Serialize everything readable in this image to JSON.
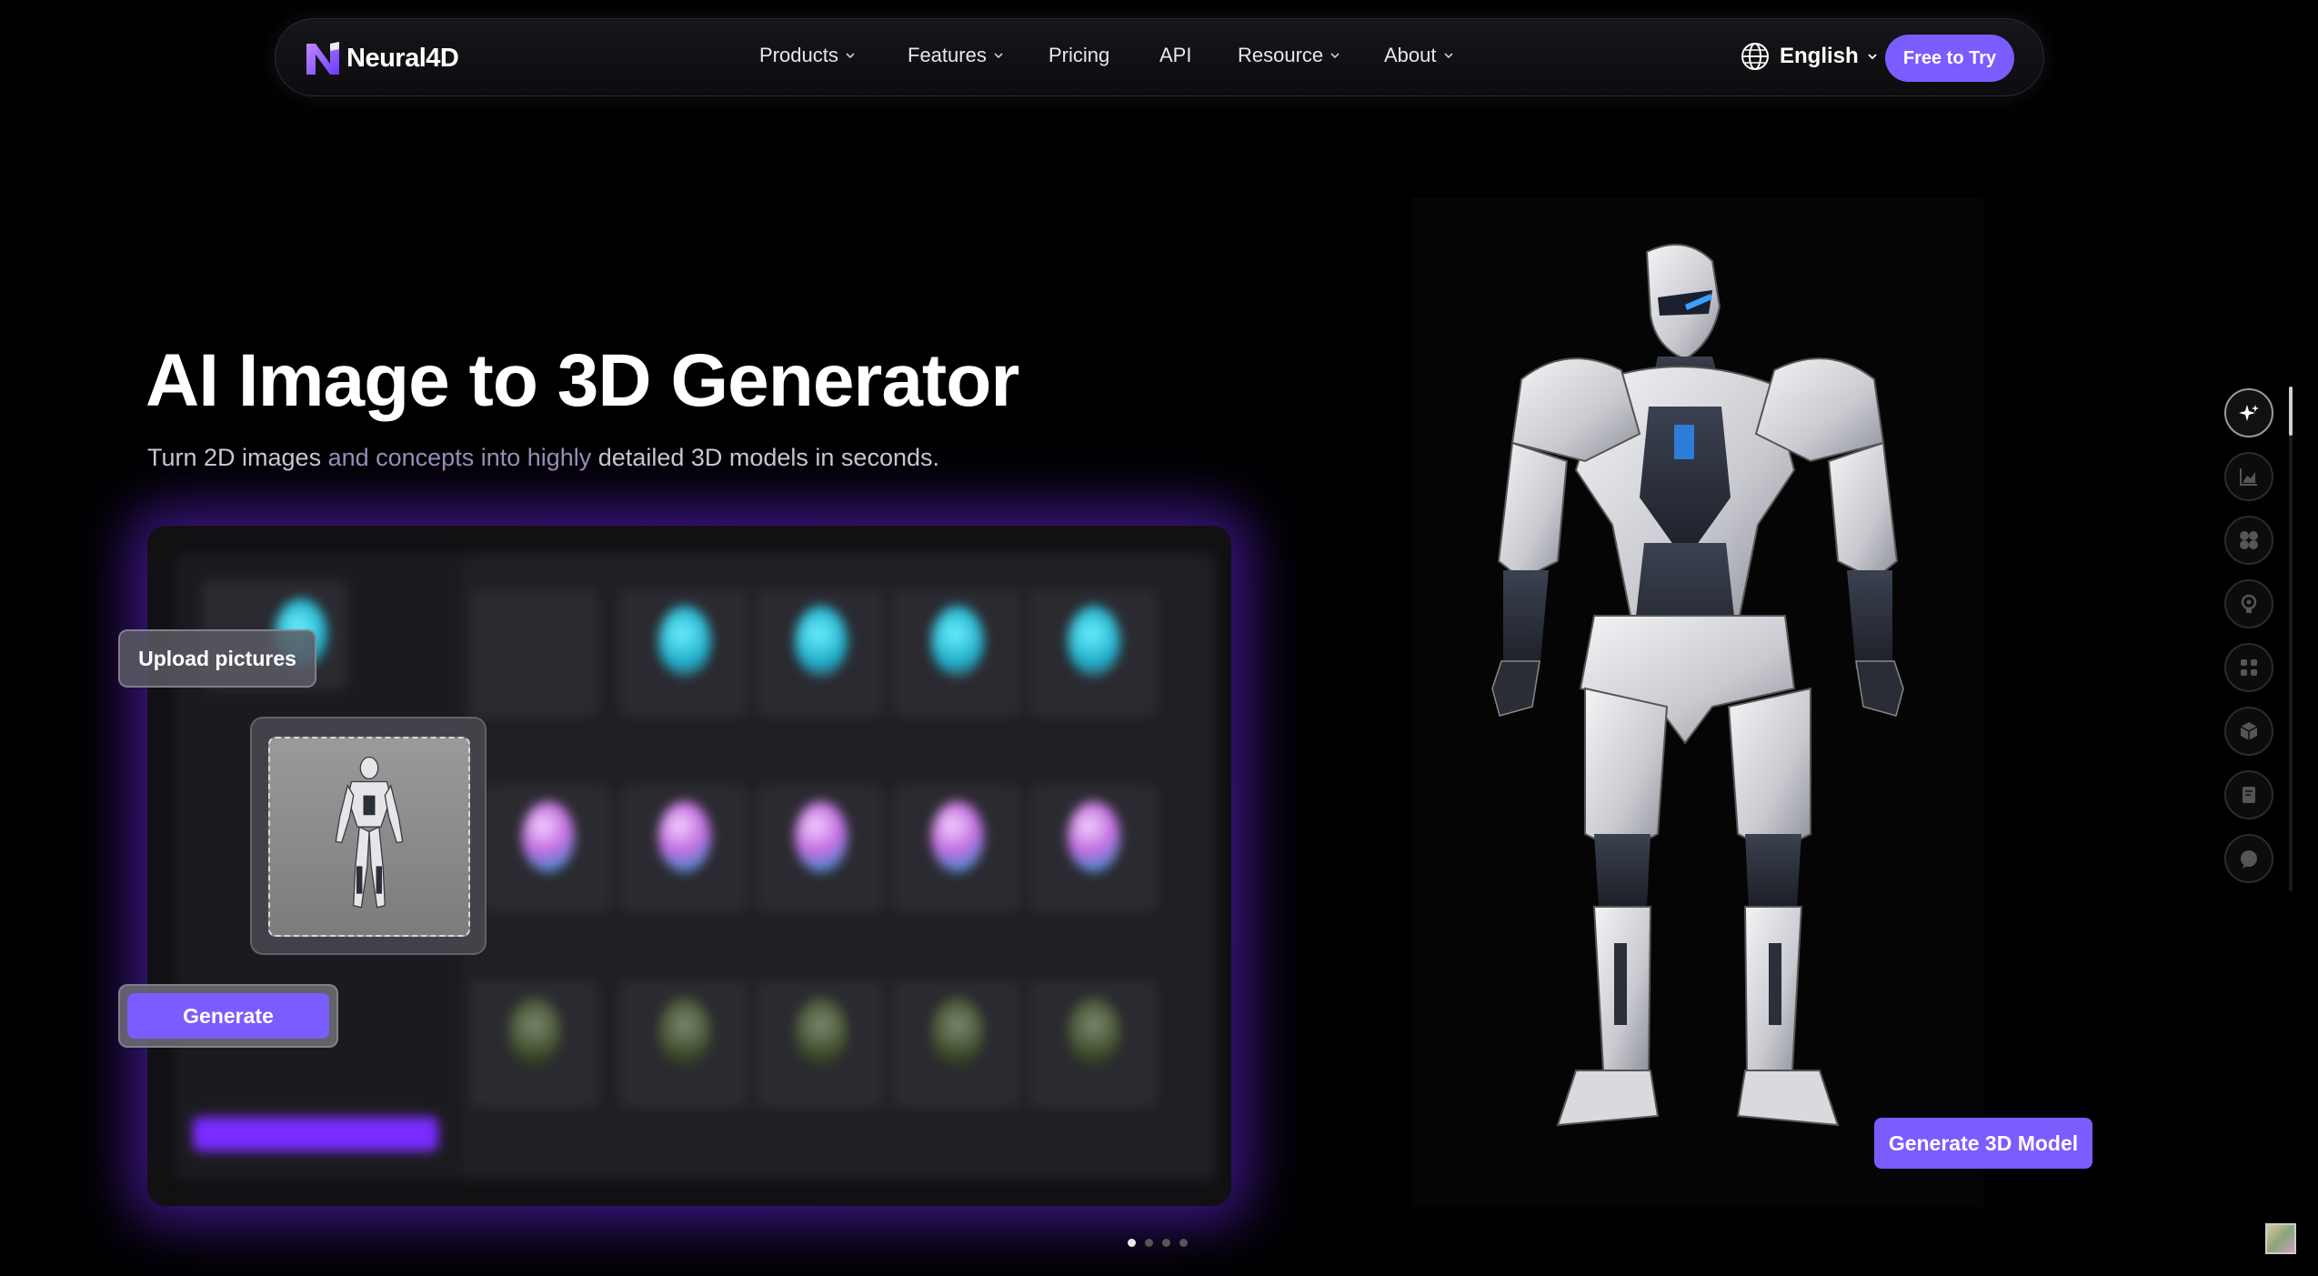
{
  "brand": {
    "name": "Neural4D",
    "accent": "#7b5cff"
  },
  "nav": {
    "items": [
      {
        "label": "Products",
        "dropdown": true
      },
      {
        "label": "Features",
        "dropdown": true
      },
      {
        "label": "Pricing",
        "dropdown": false
      },
      {
        "label": "API",
        "dropdown": false
      },
      {
        "label": "Resource",
        "dropdown": true
      },
      {
        "label": "About",
        "dropdown": true
      }
    ],
    "language": "English",
    "cta": "Free to Try"
  },
  "hero": {
    "title": "AI Image to 3D Generator",
    "subtitle_a": "Turn 2D images ",
    "subtitle_b": "and concepts into highly ",
    "subtitle_c": "detailed 3D models in seconds."
  },
  "demo": {
    "upload_label": "Upload pictures",
    "generate_label": "Generate"
  },
  "viewer": {
    "action_label": "Generate 3D Model"
  },
  "side_rail": {
    "icons": [
      "sparkle-icon",
      "chart-icon",
      "grid-icon",
      "bulb-icon",
      "nodes-icon",
      "cube-icon",
      "document-icon",
      "chat-icon"
    ],
    "active_index": 0
  },
  "carousel": {
    "slides": 4,
    "active_index": 0
  }
}
